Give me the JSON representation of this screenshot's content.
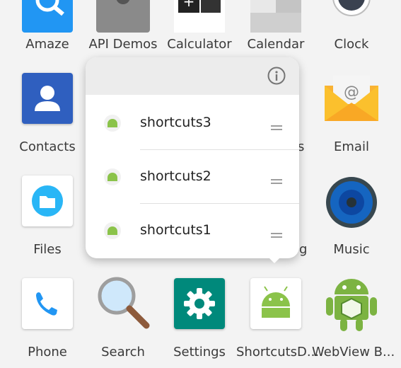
{
  "apps_row1": [
    {
      "name": "Amaze"
    },
    {
      "name": "API Demos"
    },
    {
      "name": "Calculator"
    },
    {
      "name": "Calendar"
    },
    {
      "name": "Clock"
    }
  ],
  "apps_row2": [
    {
      "name": "Contacts"
    },
    {
      "name": "Email"
    }
  ],
  "apps_row3": [
    {
      "name": "Files"
    },
    {
      "name": "Music"
    }
  ],
  "apps_row4": [
    {
      "name": "Phone"
    },
    {
      "name": "Search"
    },
    {
      "name": "Settings"
    },
    {
      "name": "ShortcutsD..."
    },
    {
      "name": "WebView B..."
    }
  ],
  "partial_labels": {
    "behind_row2": "s",
    "behind_row3": "g"
  },
  "popup": {
    "shortcuts": [
      {
        "label": "shortcuts3"
      },
      {
        "label": "shortcuts2"
      },
      {
        "label": "shortcuts1"
      }
    ]
  },
  "colors": {
    "android_green": "#8bc34a",
    "contacts_blue": "#2f5fbf",
    "settings_teal": "#00897b",
    "phone_blue": "#2196f3"
  }
}
